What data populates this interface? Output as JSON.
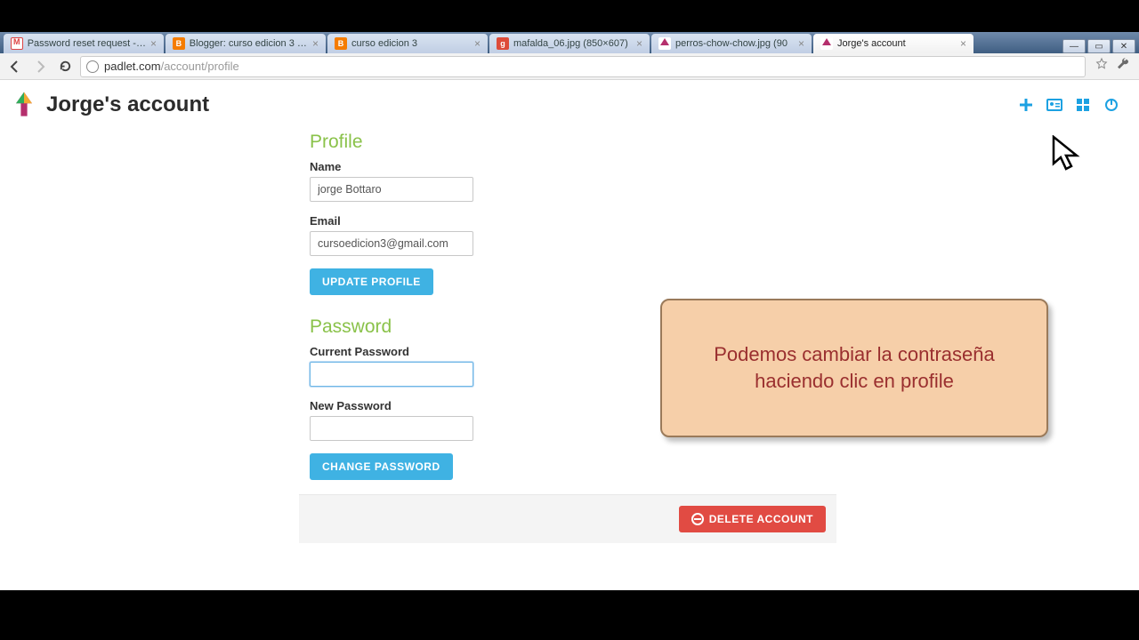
{
  "browser": {
    "tabs": [
      {
        "label": "Password reset request - cu",
        "favicon": "gmail",
        "active": false
      },
      {
        "label": "Blogger: curso edicion 3 - V",
        "favicon": "blogger",
        "active": false
      },
      {
        "label": "curso edicion 3",
        "favicon": "blogger",
        "active": false
      },
      {
        "label": "mafalda_06.jpg (850×607)",
        "favicon": "google",
        "active": false
      },
      {
        "label": "perros-chow-chow.jpg (90",
        "favicon": "padlet",
        "active": false
      },
      {
        "label": "Jorge's account",
        "favicon": "padlet",
        "active": true
      }
    ],
    "url_host": "padlet.com",
    "url_path": "/account/profile"
  },
  "header": {
    "title": "Jorge's account"
  },
  "profile": {
    "section_label": "Profile",
    "name_label": "Name",
    "name_value": "jorge Bottaro",
    "email_label": "Email",
    "email_value": "cursoedicion3@gmail.com",
    "update_btn": "UPDATE PROFILE"
  },
  "password": {
    "section_label": "Password",
    "current_label": "Current Password",
    "current_value": "",
    "new_label": "New Password",
    "new_value": "",
    "change_btn": "CHANGE PASSWORD"
  },
  "footer": {
    "delete_btn": "DELETE ACCOUNT"
  },
  "callout": {
    "text": "Podemos cambiar la contraseña haciendo clic en profile"
  }
}
